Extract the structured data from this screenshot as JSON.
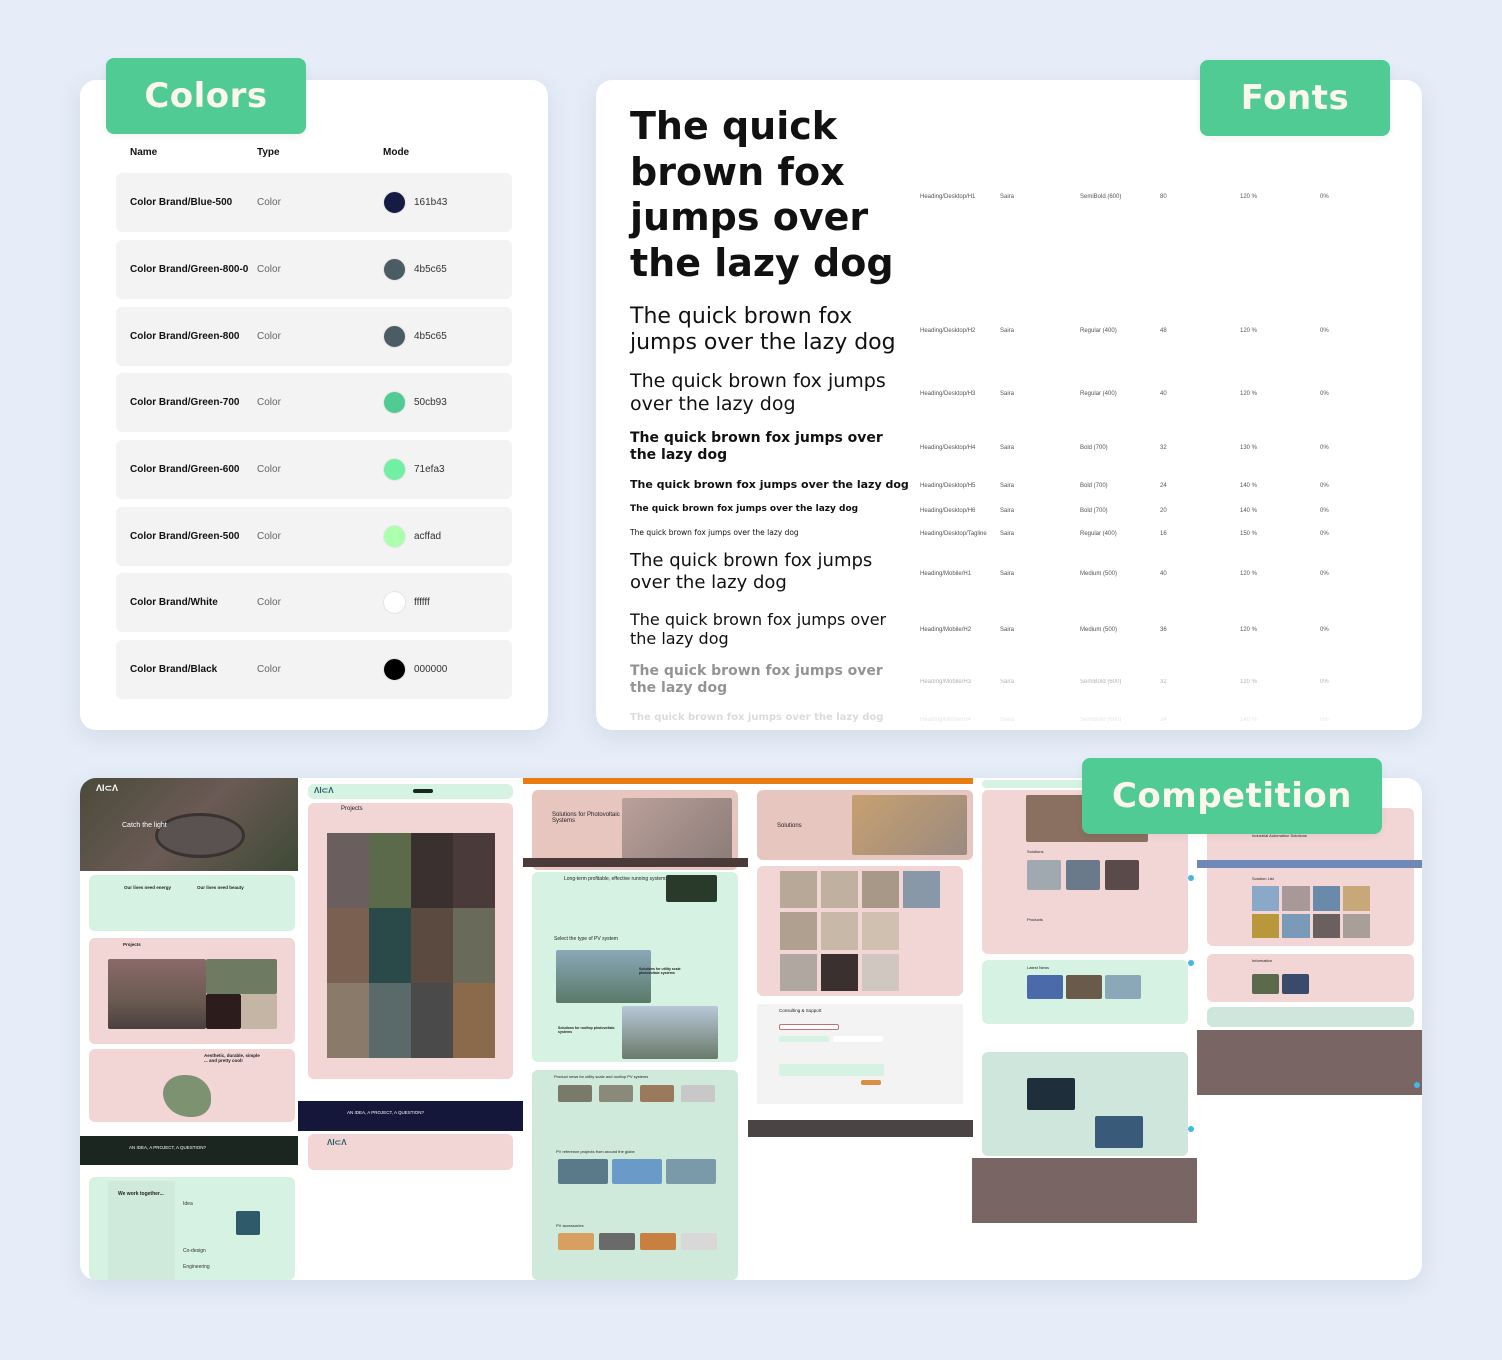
{
  "sections": {
    "colors": "Colors",
    "fonts": "Fonts",
    "competition": "Competition"
  },
  "colors_table": {
    "headers": {
      "name": "Name",
      "type": "Type",
      "mode": "Mode"
    },
    "rows": [
      {
        "name": "Color Brand/Blue-500",
        "type": "Color",
        "hex": "161b43",
        "color": "#161b43"
      },
      {
        "name": "Color Brand/Green-800-0",
        "type": "Color",
        "hex": "4b5c65",
        "color": "#4b5c65"
      },
      {
        "name": "Color Brand/Green-800",
        "type": "Color",
        "hex": "4b5c65",
        "color": "#4b5c65"
      },
      {
        "name": "Color Brand/Green-700",
        "type": "Color",
        "hex": "50cb93",
        "color": "#50cb93"
      },
      {
        "name": "Color Brand/Green-600",
        "type": "Color",
        "hex": "71efa3",
        "color": "#71efa3"
      },
      {
        "name": "Color Brand/Green-500",
        "type": "Color",
        "hex": "acffad",
        "color": "#acffad"
      },
      {
        "name": "Color Brand/White",
        "type": "Color",
        "hex": "ffffff",
        "color": "#ffffff"
      },
      {
        "name": "Color Brand/Black",
        "type": "Color",
        "hex": "000000",
        "color": "#000000"
      }
    ]
  },
  "fonts_table": {
    "sample_text": "The quick brown fox jumps over the lazy dog",
    "rows": [
      {
        "style": "Heading/Desktop/H1",
        "family": "Saira",
        "weight": "SemiBold (600)",
        "size": "80",
        "line_height": "120 %",
        "letter_spacing": "0%"
      },
      {
        "style": "Heading/Desktop/H2",
        "family": "Saira",
        "weight": "Regular (400)",
        "size": "48",
        "line_height": "120 %",
        "letter_spacing": "0%"
      },
      {
        "style": "Heading/Desktop/H3",
        "family": "Saira",
        "weight": "Regular (400)",
        "size": "40",
        "line_height": "120 %",
        "letter_spacing": "0%"
      },
      {
        "style": "Heading/Desktop/H4",
        "family": "Saira",
        "weight": "Bold (700)",
        "size": "32",
        "line_height": "130 %",
        "letter_spacing": "0%"
      },
      {
        "style": "Heading/Desktop/H5",
        "family": "Saira",
        "weight": "Bold (700)",
        "size": "24",
        "line_height": "140 %",
        "letter_spacing": "0%"
      },
      {
        "style": "Heading/Desktop/H6",
        "family": "Saira",
        "weight": "Bold (700)",
        "size": "20",
        "line_height": "140 %",
        "letter_spacing": "0%"
      },
      {
        "style": "Heading/Desktop/Tagline",
        "family": "Saira",
        "weight": "Regular (400)",
        "size": "16",
        "line_height": "150 %",
        "letter_spacing": "0%"
      },
      {
        "style": "Heading/Mobile/H1",
        "family": "Saira",
        "weight": "Medium (500)",
        "size": "40",
        "line_height": "120 %",
        "letter_spacing": "0%"
      },
      {
        "style": "Heading/Mobile/H2",
        "family": "Saira",
        "weight": "Medium (500)",
        "size": "36",
        "line_height": "120 %",
        "letter_spacing": "0%"
      },
      {
        "style": "Heading/Mobile/H3",
        "family": "Saira",
        "weight": "SemiBold (600)",
        "size": "32",
        "line_height": "120 %",
        "letter_spacing": "0%"
      },
      {
        "style": "Heading/Mobile/H4",
        "family": "Saira",
        "weight": "SemiBold (600)",
        "size": "24",
        "line_height": "140 %",
        "letter_spacing": "0%"
      }
    ]
  },
  "competition": {
    "site1": {
      "hero_title": "Catch the light",
      "energy_heading": "Our lives need energy",
      "beauty_heading": "Our lives need beauty",
      "projects_heading": "Projects",
      "aesthetic_heading": "Aesthetic, durable, simple ... and pretty cool!",
      "cta": "AN IDEA, A PROJECT, A QUESTION?",
      "work_heading": "We work together...",
      "accordion": [
        "Idea",
        "Co-design",
        "Engineering"
      ]
    },
    "site2": {
      "projects_heading": "Projects",
      "cta": "AN IDEA, A PROJECT, A QUESTION?"
    },
    "site3": {
      "hero_title": "Solutions for Photovoltaic Systems",
      "intro_heading": "Long-term profitable, effective running systems",
      "select_heading": "Select the type of PV system",
      "utility_card": "Solutions for utility scale photovoltaic systems",
      "rooftop_card": "Solutions for rooftop photovoltaic systems",
      "product_news": "Product news for utility scale and rooftop PV systems",
      "reference": "PV reference projects from around the globe",
      "accessories": "PV accessories"
    },
    "site4": {
      "hero_title": "Solutions",
      "consulting": "Consulting & Support"
    },
    "site5": {
      "solutions": "Solutions",
      "products": "Products",
      "news": "Latest News"
    },
    "site6": {
      "heading": "Industrial Automation Solutions",
      "solution_list": "Solution List",
      "information": "Information"
    }
  }
}
